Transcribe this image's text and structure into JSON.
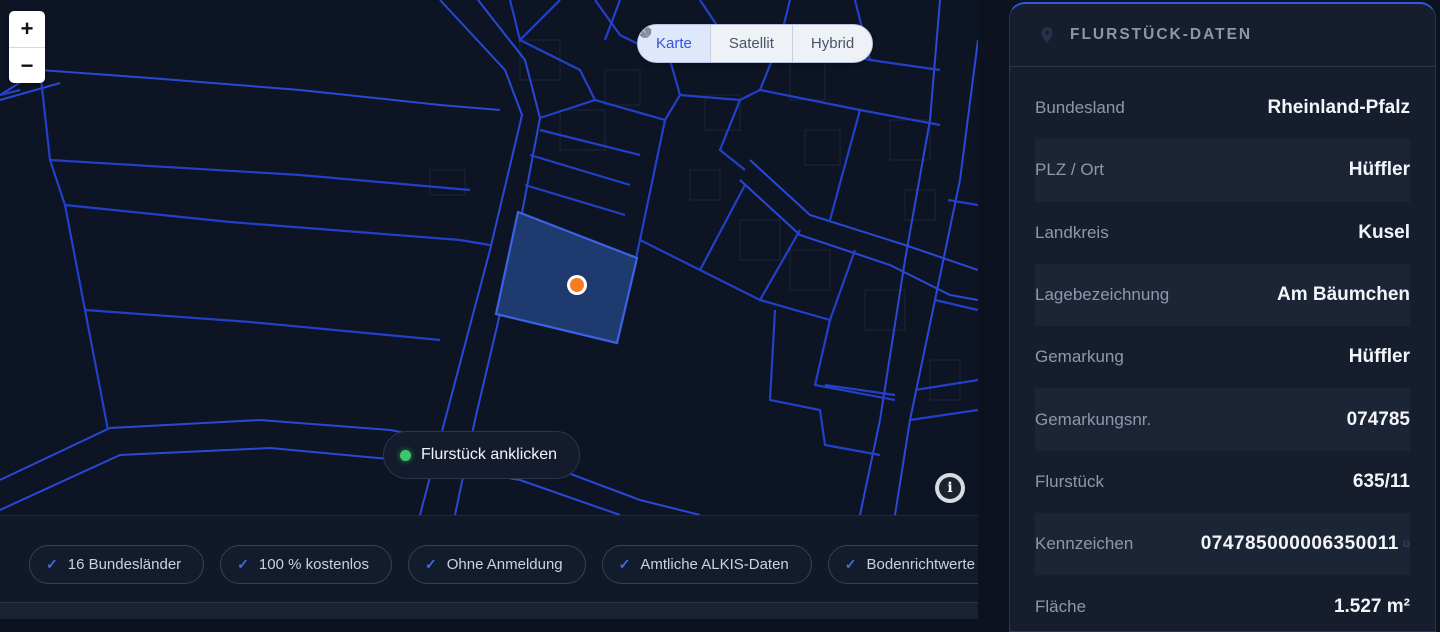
{
  "map": {
    "zoom_in_label": "+",
    "zoom_out_label": "−",
    "map_types": [
      {
        "label": "Karte",
        "icon": "map-pin-icon",
        "active": true
      },
      {
        "label": "Satellit",
        "icon": "globe-icon",
        "active": false
      },
      {
        "label": "Hybrid",
        "icon": "layers-icon",
        "active": false
      }
    ],
    "hint_text": "Flurstück anklicken",
    "info_label": "i",
    "colors": {
      "parcel_line": "#2340c8",
      "selected_fill": "#1f3a6e",
      "marker": "#f57c1f",
      "background": "#0d1424"
    }
  },
  "features": [
    {
      "label": "16 Bundesländer"
    },
    {
      "label": "100 % kostenlos"
    },
    {
      "label": "Ohne Anmeldung"
    },
    {
      "label": "Amtliche ALKIS-Daten"
    },
    {
      "label": "Bodenrichtwerte"
    }
  ],
  "panel": {
    "title": "FLURSTÜCK-DATEN",
    "rows": [
      {
        "label": "Bundesland",
        "value": "Rheinland-Pfalz"
      },
      {
        "label": "PLZ / Ort",
        "value": "Hüffler"
      },
      {
        "label": "Landkreis",
        "value": "Kusel"
      },
      {
        "label": "Lagebezeichnung",
        "value": "Am Bäumchen"
      },
      {
        "label": "Gemarkung",
        "value": "Hüffler"
      },
      {
        "label": "Gemarkungsnr.",
        "value": "074785"
      },
      {
        "label": "Flurstück",
        "value": "635/11"
      },
      {
        "label": "Kennzeichen",
        "value": "074785000006350011"
      },
      {
        "label": "Fläche",
        "value": "1.527 m²"
      }
    ]
  }
}
